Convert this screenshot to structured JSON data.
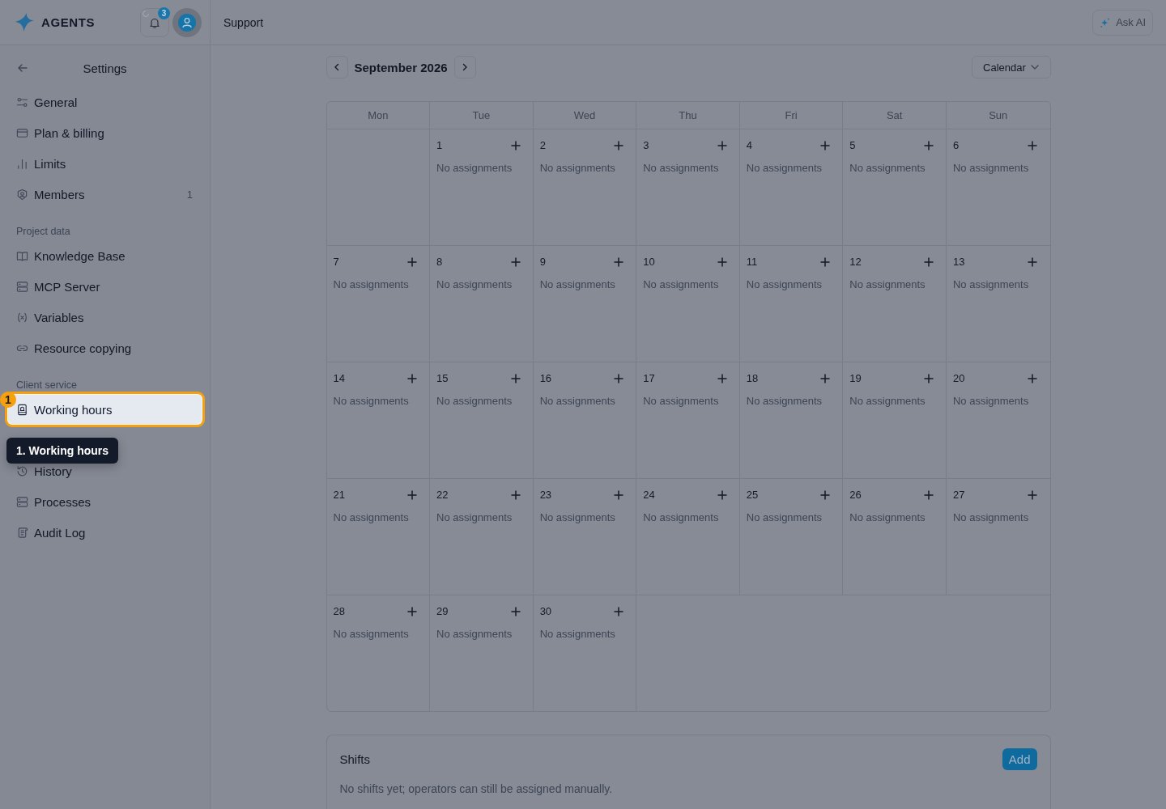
{
  "header": {
    "logo": "AGENTS",
    "notification_count": "3",
    "breadcrumb": "Support",
    "ask_ai": "Ask AI"
  },
  "sidebar": {
    "title": "Settings",
    "sections": [
      {
        "items": [
          {
            "label": "General",
            "selected": false
          },
          {
            "label": "Plan & billing",
            "selected": false
          },
          {
            "label": "Limits",
            "selected": false
          },
          {
            "label": "Members",
            "count": "1",
            "selected": false
          }
        ]
      },
      {
        "label": "Project data",
        "items": [
          {
            "label": "Knowledge Base",
            "selected": false
          },
          {
            "label": "MCP Server",
            "selected": false
          },
          {
            "label": "Variables",
            "selected": false
          },
          {
            "label": "Resource copying",
            "selected": false
          }
        ]
      },
      {
        "label": "Client service",
        "items": [
          {
            "label": "Working hours",
            "selected": true
          },
          {
            "label": "History",
            "selected": false
          },
          {
            "label": "Processes",
            "selected": false
          },
          {
            "label": "Audit Log",
            "selected": false
          }
        ]
      }
    ]
  },
  "tour": {
    "step": "1",
    "tooltip": "1. Working hours"
  },
  "calendar": {
    "month": "September 2026",
    "view": "Calendar",
    "weekdays": [
      "Mon",
      "Tue",
      "Wed",
      "Thu",
      "Fri",
      "Sat",
      "Sun"
    ],
    "weeks": [
      [
        {
          "day": "1",
          "note": "No assignments"
        },
        {
          "day": "2",
          "note": "No assignments"
        },
        {
          "day": "3",
          "note": "No assignments"
        },
        {
          "day": "4",
          "note": "No assignments"
        },
        {
          "day": "5",
          "note": "No assignments"
        },
        {
          "day": "6",
          "note": "No assignments"
        }
      ],
      [
        {
          "day": "7",
          "note": "No assignments"
        },
        {
          "day": "8",
          "note": "No assignments"
        },
        {
          "day": "9",
          "note": "No assignments"
        },
        {
          "day": "10",
          "note": "No assignments"
        },
        {
          "day": "11",
          "note": "No assignments"
        },
        {
          "day": "12",
          "note": "No assignments"
        },
        {
          "day": "13",
          "note": "No assignments"
        }
      ],
      [
        {
          "day": "14",
          "note": "No assignments"
        },
        {
          "day": "15",
          "note": "No assignments"
        },
        {
          "day": "16",
          "note": "No assignments"
        },
        {
          "day": "17",
          "note": "No assignments"
        },
        {
          "day": "18",
          "note": "No assignments"
        },
        {
          "day": "19",
          "note": "No assignments"
        },
        {
          "day": "20",
          "note": "No assignments"
        }
      ],
      [
        {
          "day": "21",
          "note": "No assignments"
        },
        {
          "day": "22",
          "note": "No assignments"
        },
        {
          "day": "23",
          "note": "No assignments"
        },
        {
          "day": "24",
          "note": "No assignments"
        },
        {
          "day": "25",
          "note": "No assignments"
        },
        {
          "day": "26",
          "note": "No assignments"
        },
        {
          "day": "27",
          "note": "No assignments"
        }
      ],
      [
        {
          "day": "28",
          "note": "No assignments"
        },
        {
          "day": "29",
          "note": "No assignments"
        },
        {
          "day": "30",
          "note": "No assignments"
        }
      ]
    ]
  },
  "shifts": {
    "title": "Shifts",
    "add": "Add",
    "empty_text": "No shifts yet; operators can still be assigned manually."
  }
}
